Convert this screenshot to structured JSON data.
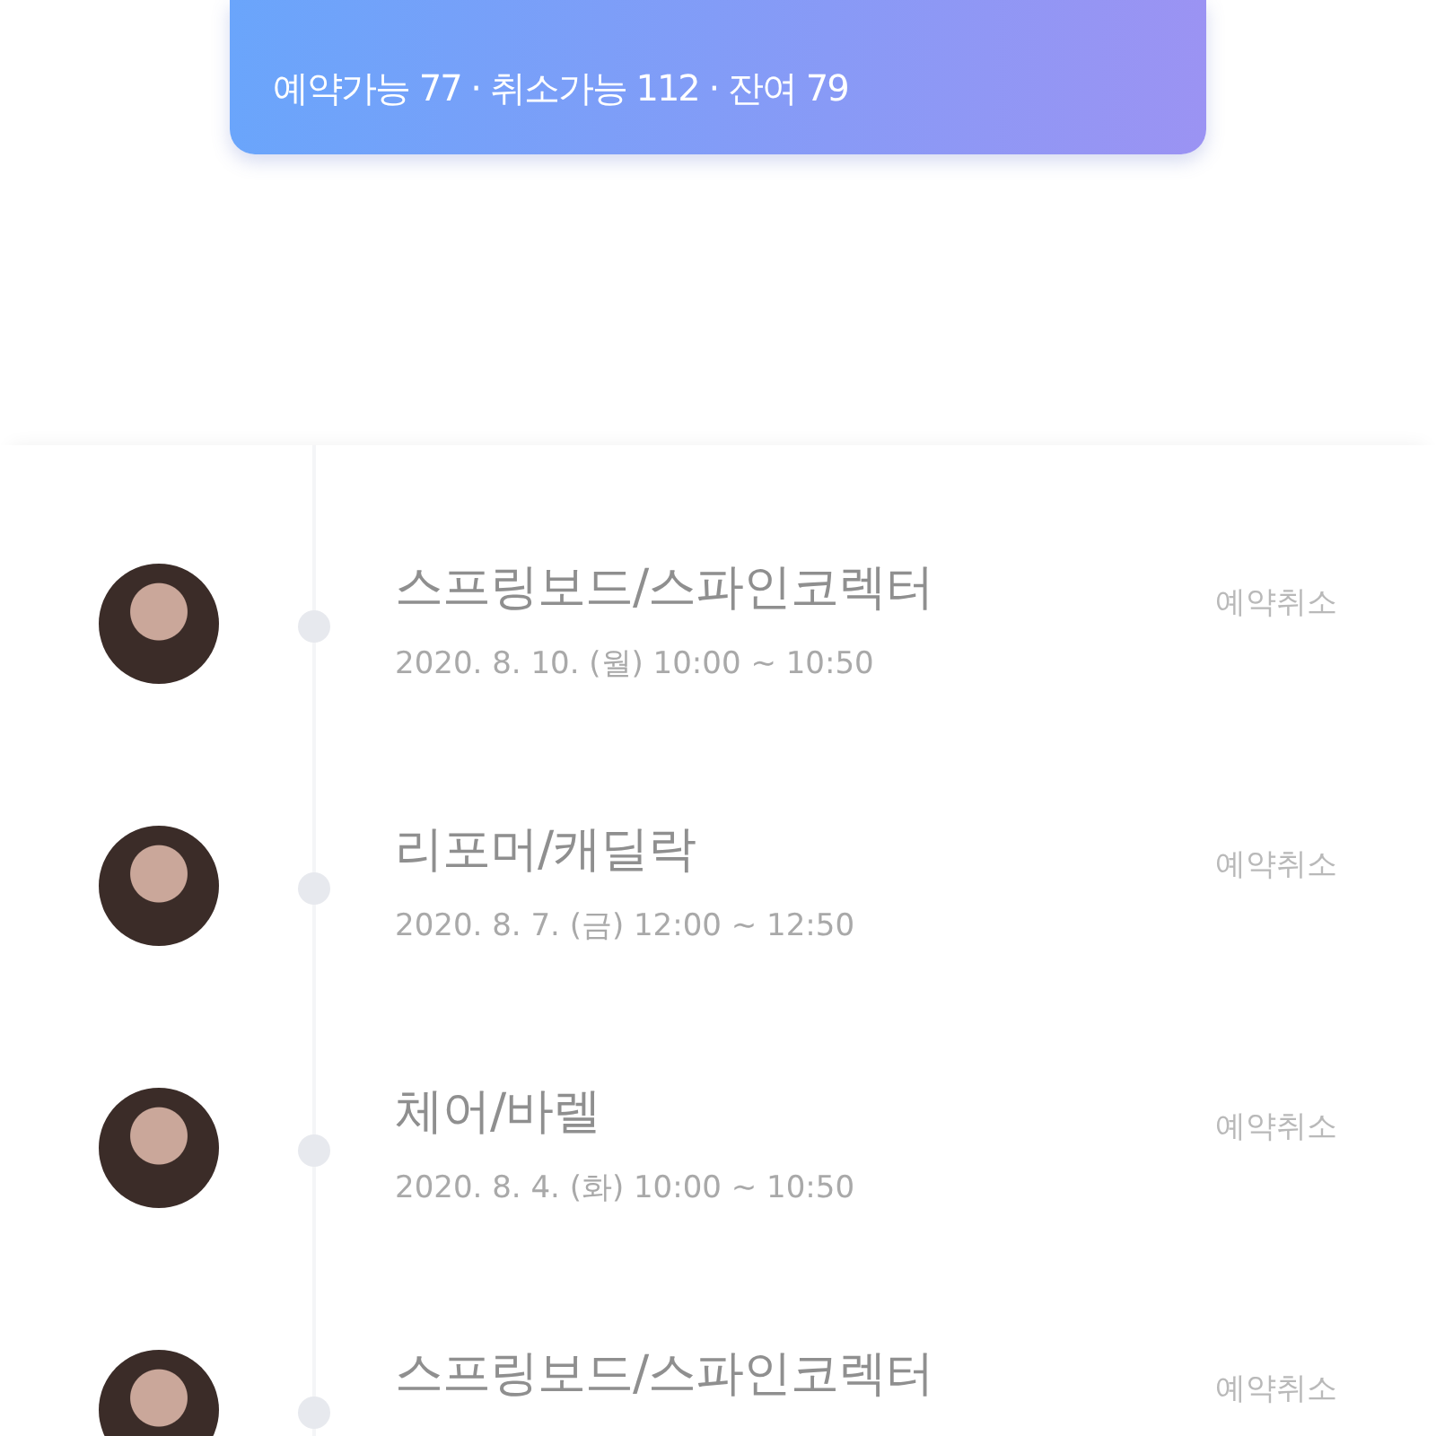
{
  "summary": {
    "counts": "예약가능 77 · 취소가능 112 · 잔여 79"
  },
  "reservations": [
    {
      "title": "스프링보드/스파인코렉터",
      "date": "2020. 8. 10. (월) 10:00 ~ 10:50",
      "action": "예약취소"
    },
    {
      "title": "리포머/캐딜락",
      "date": "2020. 8. 7. (금) 12:00 ~ 12:50",
      "action": "예약취소"
    },
    {
      "title": "체어/바렐",
      "date": "2020. 8. 4. (화) 10:00 ~ 10:50",
      "action": "예약취소"
    },
    {
      "title": "스프링보드/스파인코렉터",
      "action": "예약취소"
    }
  ]
}
